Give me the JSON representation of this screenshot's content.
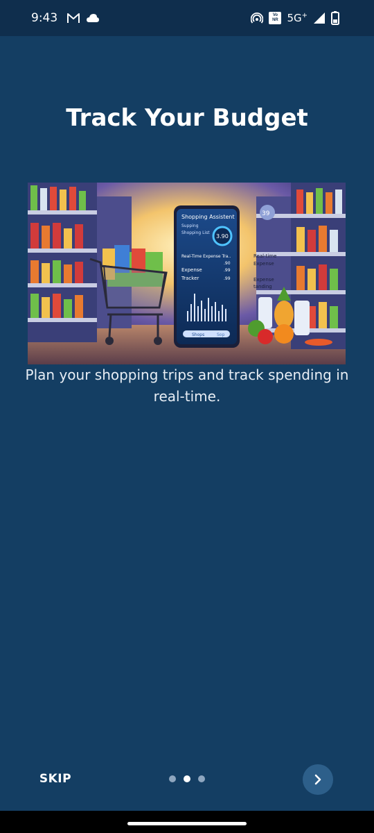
{
  "status_bar": {
    "time": "9:43",
    "network": "5G",
    "network_plus": "+",
    "volte_line1": "Vo",
    "volte_line2": "NR",
    "icons": [
      "gmail-icon",
      "cloud-icon",
      "hotspot-icon",
      "volte-icon",
      "signal-icon",
      "battery-icon"
    ]
  },
  "onboarding": {
    "title": "Track Your Budget",
    "description": "Plan your shopping trips and track spending in real-time.",
    "illustration": {
      "phone_title": "Shopping Assistent",
      "phone_line1": "Supping",
      "phone_line2": "Shopping List",
      "amount": "3.90",
      "realtime_label": "Real-Time Expense Tra..",
      "expense_label": "Expense",
      "tracker_label": "Tracker",
      "price_1": ".90",
      "price_2": ".99",
      "price_3": ".99",
      "side_label_1": "Real-time",
      "side_label_2": "Expense",
      "side_label_3": "Expense",
      "side_label_4": "tanding",
      "badge": "39",
      "tab_1": "Shops",
      "tab_2": "Sop"
    }
  },
  "navigation": {
    "skip_label": "SKIP",
    "page_count": 3,
    "active_page": 2,
    "next_icon": "chevron-right-icon"
  },
  "colors": {
    "background": "#143e63",
    "status_bar": "#0f2e4d",
    "next_button": "#2d5f8a",
    "dot_inactive": "#8ea6bf",
    "dot_active": "#ffffff"
  }
}
